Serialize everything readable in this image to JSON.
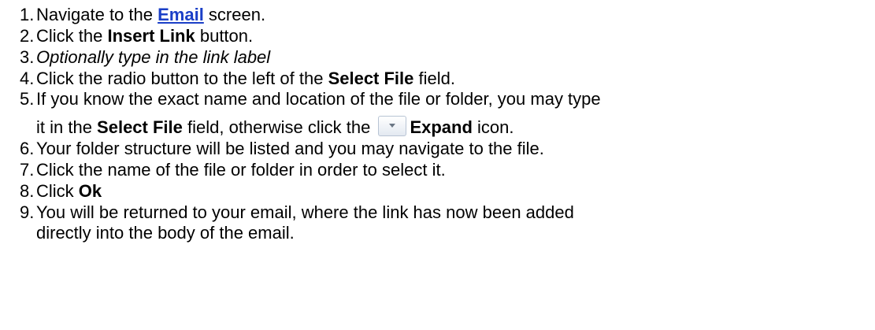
{
  "steps": [
    {
      "num": "1.",
      "before": "Navigate to the ",
      "link": "Email",
      "after": " screen."
    },
    {
      "num": "2.",
      "before": "Click the ",
      "bold": "Insert Link",
      "after": " button."
    },
    {
      "num": "3.",
      "italic": "Optionally type in the link label"
    },
    {
      "num": "4.",
      "before": "Click the radio button to the left of the ",
      "bold": "Select File",
      "after": " field."
    },
    {
      "num": "5.",
      "line1": "If you know the exact name and location of the file or folder, you may type",
      "line2_before": "it in the ",
      "line2_bold": "Select File",
      "line2_mid": " field, otherwise click the ",
      "line2_icon": "expand-icon",
      "line2_bold2": "Expand",
      "line2_after": " icon."
    },
    {
      "num": "6.",
      "text": "Your folder structure will be listed and you may navigate to the file."
    },
    {
      "num": "7.",
      "text": "Click the name of the file or folder in order to select it."
    },
    {
      "num": "8.",
      "before": "Click ",
      "bold": "Ok"
    },
    {
      "num": "9.",
      "line1": "You will be returned to your email, where the link has now been added",
      "line2": "directly into the body of the email."
    }
  ],
  "colors": {
    "link": "#1a3fc7",
    "text": "#000000"
  }
}
